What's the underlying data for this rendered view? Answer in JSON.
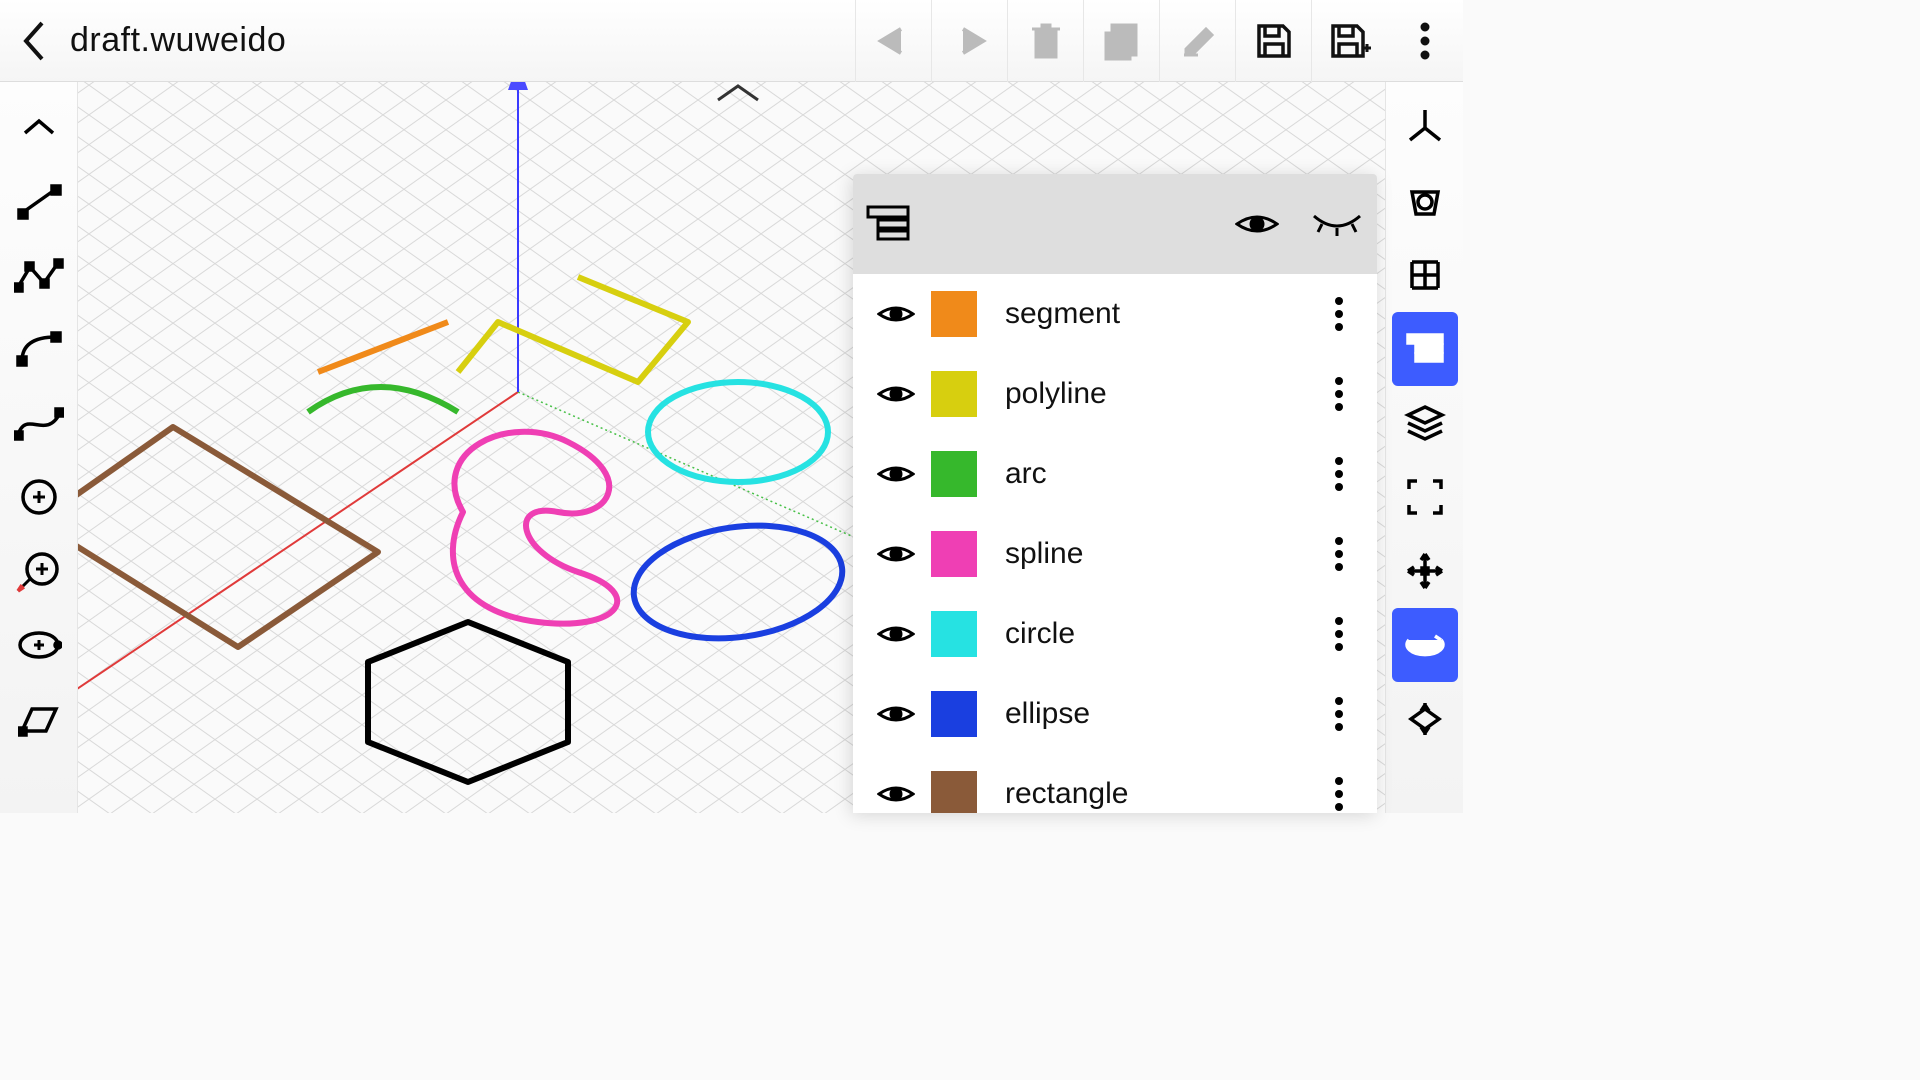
{
  "header": {
    "file_title": "draft.wuweido"
  },
  "colors": {
    "accent": "#3d5cff",
    "axis_x": "#e03a3a",
    "axis_y": "#48c048",
    "axis_z": "#3a3aff"
  },
  "layers": [
    {
      "label": "segment",
      "color": "#f08a1a"
    },
    {
      "label": "polyline",
      "color": "#d7cf0f"
    },
    {
      "label": "arc",
      "color": "#36b82c"
    },
    {
      "label": "spline",
      "color": "#ef3fb4"
    },
    {
      "label": "circle",
      "color": "#26e2e2"
    },
    {
      "label": "ellipse",
      "color": "#1a3fe0"
    },
    {
      "label": "rectangle",
      "color": "#8a5a39"
    }
  ]
}
